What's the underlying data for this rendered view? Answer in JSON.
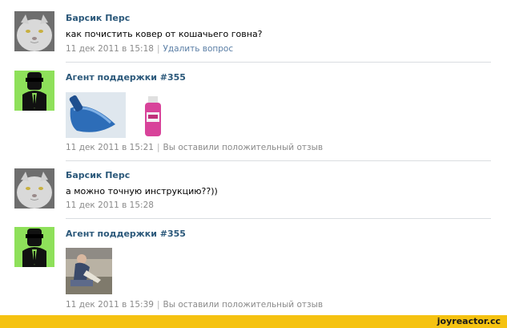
{
  "messages": [
    {
      "author": "Барсик Перс",
      "text": "как почистить ковер от кошачьего говна?",
      "date": "11 дек 2011 в 15:18",
      "action": "Удалить вопрос"
    },
    {
      "author": "Агент поддержки #355",
      "text": "",
      "date": "11 дек 2011 в 15:21",
      "action": "Вы оставили положительный отзыв",
      "attachments": [
        "blue-dustpan-photo",
        "vanish-carpet-cleaner-photo"
      ]
    },
    {
      "author": "Барсик Перс",
      "text": "а можно точную инструкцию??))",
      "date": "11 дек 2011 в 15:28",
      "action": ""
    },
    {
      "author": "Агент поддержки #355",
      "text": "",
      "date": "11 дек 2011 в 15:39",
      "action": "Вы оставили положительный отзыв",
      "attachments": [
        "person-cleaning-carpet-photo"
      ]
    }
  ],
  "watermark": "joyreactor.cc",
  "colors": {
    "author_link": "#2b587a",
    "meta_text": "#8a8a8a",
    "meta_link": "#5a7ea5",
    "agent_avatar_bg": "#8ee05a",
    "footer_bg": "#f5c211"
  }
}
